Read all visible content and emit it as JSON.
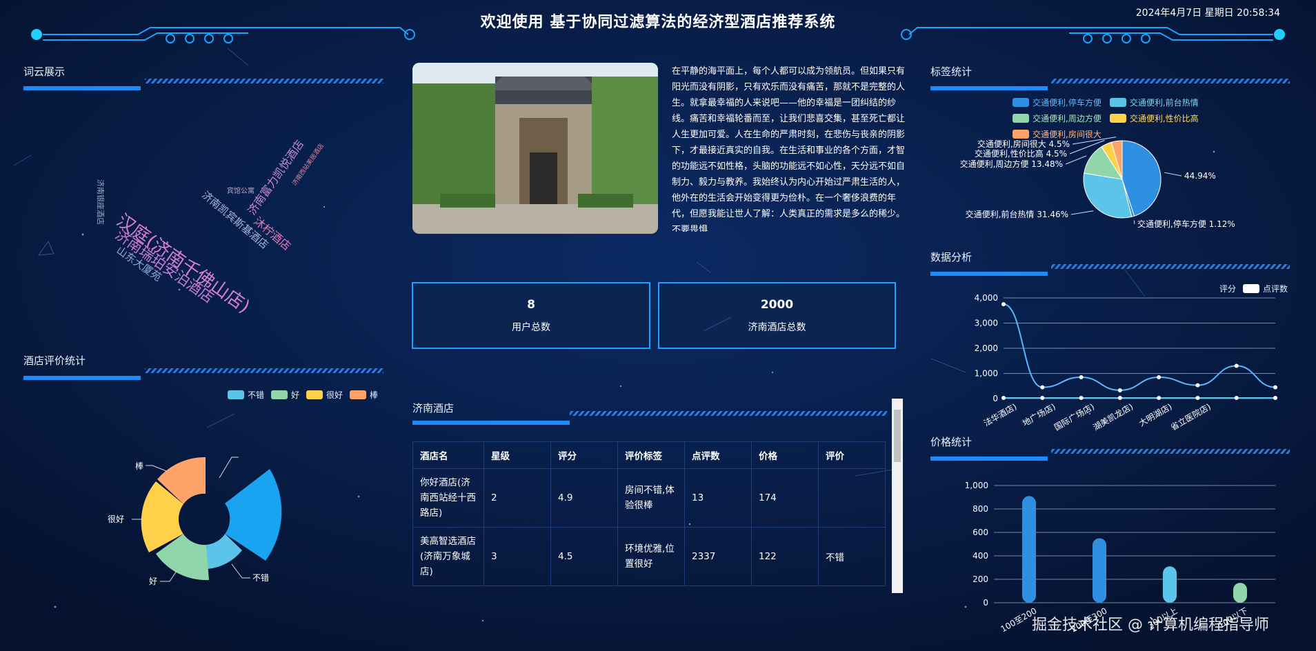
{
  "header": {
    "title": "欢迎使用 基于协同过滤算法的经济型酒店推荐系统",
    "datetime": "2024年4月7日 星期日 20:58:34"
  },
  "word_cloud": {
    "title": "词云展示",
    "words": [
      {
        "text": "汉庭(济南千佛山店)",
        "color": "#d77fd2"
      },
      {
        "text": "济南瑞珀安泊酒店",
        "color": "#c77bd6"
      },
      {
        "text": "山东大厦苑",
        "color": "#8fa7d6"
      },
      {
        "text": "济南银座酒店",
        "color": "#9aa8c4"
      },
      {
        "text": "济南凯宾斯基酒店",
        "color": "#a7b4d9"
      },
      {
        "text": "沐柠酒店",
        "color": "#e07cb5"
      },
      {
        "text": "济南富力凯悦酒店",
        "color": "#c38ad0"
      },
      {
        "text": "宾馆公寓",
        "color": "#b0a8c8"
      },
      {
        "text": "济南西站美居酒店",
        "color": "#d98a9a"
      }
    ]
  },
  "review_stats": {
    "title": "酒店评价统计",
    "legend": [
      {
        "label": "不错",
        "color": "#5bc4e8"
      },
      {
        "label": "好",
        "color": "#91d5aa"
      },
      {
        "label": "很好",
        "color": "#ffd04a"
      },
      {
        "label": "棒",
        "color": "#ffa36b"
      }
    ],
    "labels": {
      "bang": "棒",
      "henhao": "很好",
      "hao": "好",
      "bucuo": "不错"
    }
  },
  "intro": {
    "text": "在平静的海平面上，每个人都可以成为领航员。但如果只有阳光而没有阴影，只有欢乐而没有痛苦，那就不是完整的人生。就拿最幸福的人来说吧——他的幸福是一团纠结的纱线。痛苦和幸福轮番而至，让我们悲喜交集，甚至死亡都让人生更加可爱。人在生命的严肃时刻，在悲伤与丧亲的阴影下，才最接近真实的自我。在生活和事业的各个方面，才智的功能远不如性格，头脑的功能远不如心性，天分远不如自制力、毅力与教养。我始终认为内心开始过严肃生活的人，他外在的生活会开始变得更为俭朴。在一个奢侈浪费的年代，但愿我能让世人了解：人类真正的需求是多么的稀少。不要畏惧"
  },
  "stats": {
    "users": {
      "value": "8",
      "label": "用户总数"
    },
    "hotels": {
      "value": "2000",
      "label": "济南酒店总数"
    }
  },
  "hotel_table": {
    "title": "济南酒店",
    "headers": [
      "酒店名",
      "星级",
      "评分",
      "评价标签",
      "点评数",
      "价格",
      "评价"
    ],
    "rows": [
      [
        "你好酒店(济南西站经十西路店)",
        "2",
        "4.9",
        "房间不错,体验很棒",
        "13",
        "174",
        ""
      ],
      [
        "美高智选酒店(济南万象城店)",
        "3",
        "4.5",
        "环境优雅,位置很好",
        "2337",
        "122",
        "不错"
      ]
    ]
  },
  "tag_stats": {
    "title": "标签统计",
    "chart_data": {
      "type": "pie",
      "legend": [
        {
          "label": "交通便利,停车方便",
          "color": "#2f8fe0"
        },
        {
          "label": "交通便利,前台热情",
          "color": "#5bc4e8"
        },
        {
          "label": "交通便利,周边方便",
          "color": "#91d5aa"
        },
        {
          "label": "交通便利,性价比高",
          "color": "#ffd04a"
        },
        {
          "label": "交通便利,房间很大",
          "color": "#ffa36b"
        }
      ],
      "slices": [
        {
          "label": "",
          "value": 44.94,
          "display": "44.94%",
          "color": "#2f8fe0"
        },
        {
          "label": "交通便利,停车方便",
          "value": 1.12,
          "display": "交通便利,停车方便 1.12%",
          "color": "#2f8fe0"
        },
        {
          "label": "交通便利,前台热情",
          "value": 31.46,
          "display": "交通便利,前台热情 31.46%",
          "color": "#5bc4e8"
        },
        {
          "label": "交通便利,周边方便",
          "value": 13.48,
          "display": "交通便利,周边方便 13.48%",
          "color": "#91d5aa"
        },
        {
          "label": "交通便利,性价比高",
          "value": 4.5,
          "display": "交通便利,性价比高 4.5%",
          "color": "#ffd04a"
        },
        {
          "label": "交通便利,房间很大",
          "value": 4.5,
          "display": "交通便利,房间很大 4.5%",
          "color": "#ffa36b"
        }
      ]
    }
  },
  "data_analysis": {
    "title": "数据分析",
    "chart_data": {
      "type": "line",
      "legend": [
        {
          "label": "评分",
          "color": "#5bc4e8"
        },
        {
          "label": "点评数",
          "color": "#ffffff"
        }
      ],
      "categories": [
        "法华酒店)",
        "地广场店)",
        "国际广场店)",
        "湖美凯龙店)",
        "大明湖店)",
        "省立医院店)",
        ""
      ],
      "series": [
        {
          "name": "点评数",
          "values": [
            3750,
            450,
            850,
            330,
            850,
            530,
            1300,
            450
          ]
        },
        {
          "name": "评分",
          "values": [
            4.8,
            4.7,
            4.9,
            4.6,
            4.8,
            4.7,
            4.9,
            4.8
          ]
        }
      ],
      "y_ticks": [
        "0",
        "1,000",
        "2,000",
        "3,000",
        "4,000"
      ],
      "ylim": [
        0,
        4000
      ]
    }
  },
  "price_stats": {
    "title": "价格统计",
    "chart_data": {
      "type": "bar",
      "categories": [
        "100至200",
        "200至300",
        "300以上",
        "100以下"
      ],
      "values": [
        910,
        550,
        310,
        170
      ],
      "colors": [
        "#2f8fe0",
        "#2f8fe0",
        "#5bc4e8",
        "#91d5aa"
      ],
      "y_ticks": [
        "0",
        "200",
        "400",
        "600",
        "800",
        "1,000"
      ],
      "ylim": [
        0,
        1000
      ]
    }
  },
  "watermark": "掘金技术社区 @ 计算机编程指导师"
}
